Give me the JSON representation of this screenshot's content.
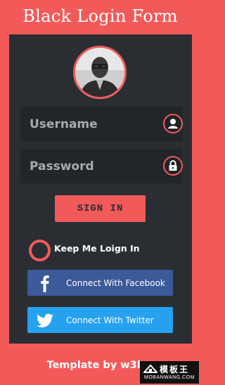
{
  "page": {
    "title": "Black Login Form",
    "footer": "Template by w3lay"
  },
  "form": {
    "username_placeholder": "Username",
    "password_placeholder": "Password",
    "signin_label": "SIGN IN",
    "remember_label": "Keep Me Loign In"
  },
  "social": {
    "facebook_label": "Connect With Facebook",
    "twitter_label": "Connect With Twitter"
  },
  "watermark": {
    "main": "模板王",
    "sub": "MOBANWANG.COM"
  },
  "colors": {
    "background": "#f25a5a",
    "panel": "#2a2e33",
    "input": "#22252a",
    "accent": "#f25a5a",
    "facebook": "#3b5a9a",
    "twitter": "#26a1f0"
  },
  "icons": [
    "user-icon",
    "lock-icon",
    "facebook-icon",
    "twitter-icon"
  ]
}
